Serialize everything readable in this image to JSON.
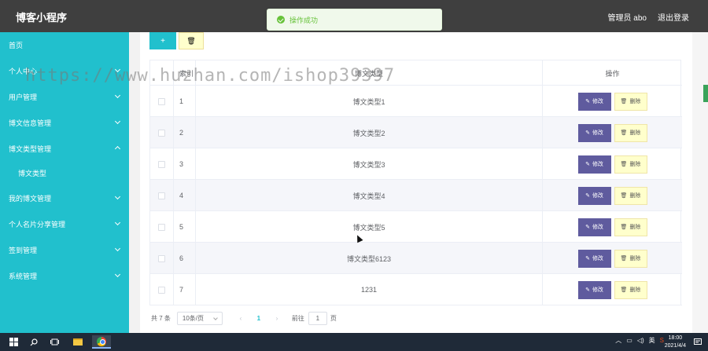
{
  "header": {
    "title": "博客小程序",
    "user": "管理员 abo",
    "logout": "退出登录"
  },
  "toast": {
    "message": "操作成功"
  },
  "sidebar": {
    "items": [
      {
        "label": "首页",
        "expandable": false
      },
      {
        "label": "个人中心",
        "expandable": true
      },
      {
        "label": "用户管理",
        "expandable": true
      },
      {
        "label": "博文信息管理",
        "expandable": true
      },
      {
        "label": "博文类型管理",
        "expandable": true,
        "expanded": true
      },
      {
        "label": "博文类型",
        "sub": true
      },
      {
        "label": "我的博文管理",
        "expandable": true
      },
      {
        "label": "个人名片分享管理",
        "expandable": true
      },
      {
        "label": "签到管理",
        "expandable": true
      },
      {
        "label": "系统管理",
        "expandable": true
      }
    ]
  },
  "toolbar": {
    "add_label": "+",
    "delete_label": "🗑"
  },
  "table": {
    "headers": {
      "index": "索引",
      "name": "博文类型",
      "operation": "操作"
    },
    "edit_label": "修改",
    "delete_label": "删除",
    "rows": [
      {
        "index": "1",
        "name": "博文类型1"
      },
      {
        "index": "2",
        "name": "博文类型2"
      },
      {
        "index": "3",
        "name": "博文类型3"
      },
      {
        "index": "4",
        "name": "博文类型4"
      },
      {
        "index": "5",
        "name": "博文类型5"
      },
      {
        "index": "6",
        "name": "博文类型6123"
      },
      {
        "index": "7",
        "name": "1231"
      }
    ]
  },
  "pagination": {
    "total": "共 7 条",
    "page_size": "10条/页",
    "prev": "‹",
    "current": "1",
    "next": "›",
    "goto_prefix": "前往",
    "goto_value": "1",
    "goto_suffix": "页"
  },
  "watermark": "https://www.huzhan.com/ishop39397",
  "taskbar": {
    "tray_text": "英",
    "time": "18:00",
    "date": "2021/4/4"
  },
  "colors": {
    "header_bg": "#3f3f3f",
    "sidebar_bg": "#21c0cd",
    "edit_button": "#5f5b9e",
    "delete_button": "#ffffcc",
    "toast_success": "#67c23a"
  }
}
